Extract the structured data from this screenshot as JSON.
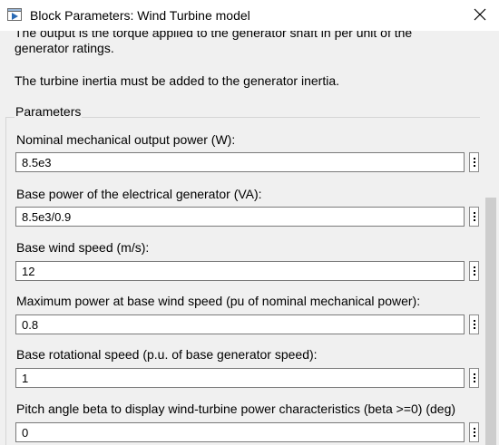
{
  "window": {
    "title": "Block Parameters: Wind Turbine model",
    "app_icon": "simulink-block-icon",
    "close_icon": "close-icon"
  },
  "description": {
    "line1": "The output is the torque applied to the generator shaft in per unit of the",
    "line2": "generator ratings.",
    "line3": "The turbine inertia must be added to the generator inertia."
  },
  "parameters": {
    "group_label": "Parameters",
    "fields": [
      {
        "label": "Nominal mechanical output power (W):",
        "value": "8.5e3"
      },
      {
        "label": "Base power of the electrical generator (VA):",
        "value": "8.5e3/0.9"
      },
      {
        "label": "Base wind speed (m/s):",
        "value": "12"
      },
      {
        "label": "Maximum power at base wind speed (pu of nominal mechanical power):",
        "value": "0.8"
      },
      {
        "label": "Base rotational speed (p.u. of base generator speed):",
        "value": "1"
      },
      {
        "label": "Pitch angle beta to display wind-turbine power characteristics (beta >=0)  (deg)",
        "value": "0"
      }
    ]
  }
}
